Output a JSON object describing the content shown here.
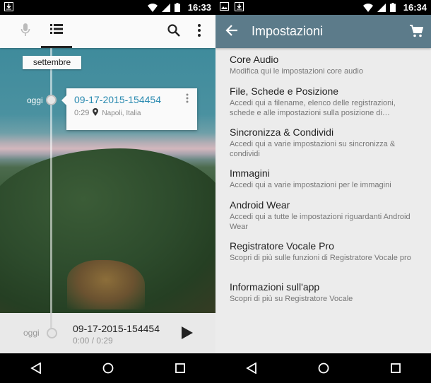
{
  "left": {
    "statusbar": {
      "time": "16:33"
    },
    "toolbar": {},
    "timeline": {
      "month": "settembre",
      "day_label": "oggi",
      "card": {
        "title": "09-17-2015-154454",
        "duration": "0:29",
        "location": "Napoli, Italia"
      }
    },
    "player": {
      "day_label": "oggi",
      "title": "09-17-2015-154454",
      "progress": "0:00 / 0:29"
    }
  },
  "right": {
    "statusbar": {
      "time": "16:34"
    },
    "toolbar": {
      "title": "Impostazioni"
    },
    "items": [
      {
        "title": "Core Audio",
        "subtitle": "Modifica qui le impostazioni core audio"
      },
      {
        "title": "File, Schede e Posizione",
        "subtitle": "Accedi qui a filename, elenco delle registrazioni, schede e alle impostazioni sulla posizione di…"
      },
      {
        "title": "Sincronizza & Condividi",
        "subtitle": "Accedi qui a varie impostazioni su sincronizza & condividi"
      },
      {
        "title": "Immagini",
        "subtitle": "Accedi qui a varie impostazioni per le immagini"
      },
      {
        "title": "Android Wear",
        "subtitle": "Accedi qui a tutte le impostazioni riguardanti Android Wear"
      },
      {
        "title": "Registratore Vocale Pro",
        "subtitle": "Scopri di più sulle funzioni di Registratore Vocale pro"
      },
      {
        "title": "Informazioni sull'app",
        "subtitle": "Scopri di più su Registratore Vocale"
      }
    ]
  },
  "colors": {
    "accent_blue": "#2a8ab0",
    "toolbar_right": "#5c7b8a"
  },
  "icons": [
    "download-icon",
    "wifi-icon",
    "signal-icon",
    "battery-icon",
    "mic-icon",
    "list-icon",
    "search-icon",
    "more-icon",
    "location-pin-icon",
    "play-icon",
    "image-icon",
    "back-arrow-icon",
    "cart-icon",
    "nav-back-icon",
    "nav-home-icon",
    "nav-recents-icon"
  ]
}
